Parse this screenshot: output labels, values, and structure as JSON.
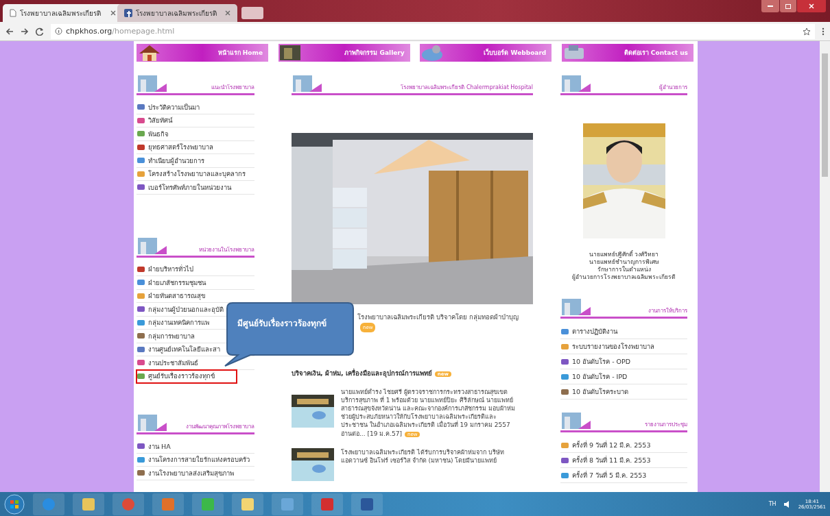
{
  "browser": {
    "tabs": [
      {
        "title": "โรงพยาบาลเฉลิมพระเกียรติ",
        "selected": true,
        "kind": "page"
      },
      {
        "title": "โรงพยาบาลเฉลิมพระเกียรติ",
        "selected": false,
        "kind": "facebook"
      }
    ],
    "url_host": "chpkhos.org",
    "url_path": "/homepage.html"
  },
  "nav": [
    {
      "label": "หน้าแรก Home"
    },
    {
      "label": "ภาพกิจกรรม Gallery"
    },
    {
      "label": "เว็บบอร์ด Webboard"
    },
    {
      "label": "ติดต่อเรา Contact us"
    }
  ],
  "left_sections": [
    {
      "title": "แนะนำโรงพยาบาล",
      "items": [
        {
          "label": "ประวัติความเป็นมา",
          "highlighted": false
        },
        {
          "label": "วิสัยทัศน์",
          "highlighted": false
        },
        {
          "label": "พันธกิจ",
          "highlighted": false
        },
        {
          "label": "ยุทธศาสตร์โรงพยาบาล",
          "highlighted": false
        },
        {
          "label": "ทำเนียบผู้อำนวยการ",
          "highlighted": false
        },
        {
          "label": "โครงสร้างโรงพยาบาลและบุคลากร",
          "highlighted": false
        },
        {
          "label": "เบอร์โทรศัพท์ภายในหน่วยงาน",
          "highlighted": false
        }
      ]
    },
    {
      "title": "หน่วยงานในโรงพยาบาล",
      "items": [
        {
          "label": "ฝ่ายบริหารทั่วไป",
          "highlighted": false
        },
        {
          "label": "ฝ่ายเภสัชกรรมชุมชน",
          "highlighted": false
        },
        {
          "label": "ฝ่ายทันตสาธารณสุข",
          "highlighted": false
        },
        {
          "label": "กลุ่มงานผู้ป่วยนอกและอุบัติ",
          "highlighted": false
        },
        {
          "label": "กลุ่มงานเทคนิคการแพ",
          "highlighted": false
        },
        {
          "label": "กลุ่มการพยาบาล",
          "highlighted": false
        },
        {
          "label": "งานศูนย์เทคโนโลยีและสา",
          "highlighted": false
        },
        {
          "label": "งานประชาสัมพันธ์",
          "highlighted": false
        },
        {
          "label": "ศูนย์รับเรื่องราวร้องทุกข์",
          "highlighted": true
        }
      ]
    },
    {
      "title": "งานพัฒนาคุณภาพโรงพยาบาล",
      "items": [
        {
          "label": "งาน HA",
          "highlighted": false
        },
        {
          "label": "งานโครงการสายใยรักแห่งครอบครัว",
          "highlighted": false
        },
        {
          "label": "งานโรงพยาบาลส่งเสริมสุขภาพ",
          "highlighted": false
        }
      ]
    }
  ],
  "center": {
    "title": "โรงพยาบาลเฉลิมพระเกียรติ Chalermprakiat Hospital",
    "slide_caption": "โรงพยาบาลเฉลิมพระเกียรติ บริจาคโดย กลุ่มทอดผ้าป่าบุญ",
    "slide_badge": "new",
    "news_heading": "บริจาคเงิน, ผ้าห่ม, เครื่องมือและอุปกรณ์การแพทย์",
    "news_badge": "new",
    "news": [
      {
        "text": "นายแพทย์ดำรง ไชยศรี ผู้ตรวจราชการกระทรวงสาธารณสุขเขตบริการสุขภาพ ที่ 1 พร้อมด้วย นายแพทย์ปิยะ ศิริลักษณ์ นายแพทย์สาธารณสุขจังหวัดน่าน และคณะจากองค์การเภสัชกรรม มอบผ้าห่มช่วยผู้ประสบภัยหนาวให้กับโรงพยาบาลเฉลิมพระเกียรติและประชาชน ในอำเภอเฉลิมพระเกียรติ เมื่อวันที่ 19 มกราคม 2557",
        "more": "อ่านต่อ... [19 ม.ค.57]",
        "badge": "new"
      },
      {
        "text": "โรงพยาบาลเฉลิมพระเกียรติ ได้รับการบริจาคผ้าห่มจาก บริษัท แอดวานซ์ อินโฟร์ เซอร์วิส จำกัด (มหาชน) โดยมีนายแพทย์"
      }
    ]
  },
  "right": {
    "director_title": "ผู้อำนวยการ",
    "director_caption": [
      "นายแพทย์ปฐิศักดิ์ วงศ์วิทยา",
      "นายแพทย์ชำนาญการพิเศษ",
      "รักษาการในตำแหน่ง",
      "ผู้อำนวยการโรงพยาบาลเฉลิมพระเกียรติ"
    ],
    "sections": [
      {
        "title": "งานการให้บริการ",
        "items": [
          "ตารางปฏิบัติงาน",
          "ระบบรายงานของโรงพยาบาล",
          "10 อันดับโรค - OPD",
          "10 อันดับโรค - IPD",
          "10 อันดับโรคระบาด"
        ]
      },
      {
        "title": "รายงานการประชุม",
        "items": [
          "ครั้งที่ 9 วันที่ 12 มี.ค. 2553",
          "ครั้งที่ 8 วันที่ 11 มี.ค. 2553",
          "ครั้งที่ 7 วันที่ 5 มี.ค. 2553"
        ]
      }
    ]
  },
  "callout": {
    "text": "มีศูนย์รับเรื่องราวร้องทุกข์"
  },
  "taskbar": {
    "language": "TH",
    "time": "18:41",
    "date": "26/03/2561"
  }
}
